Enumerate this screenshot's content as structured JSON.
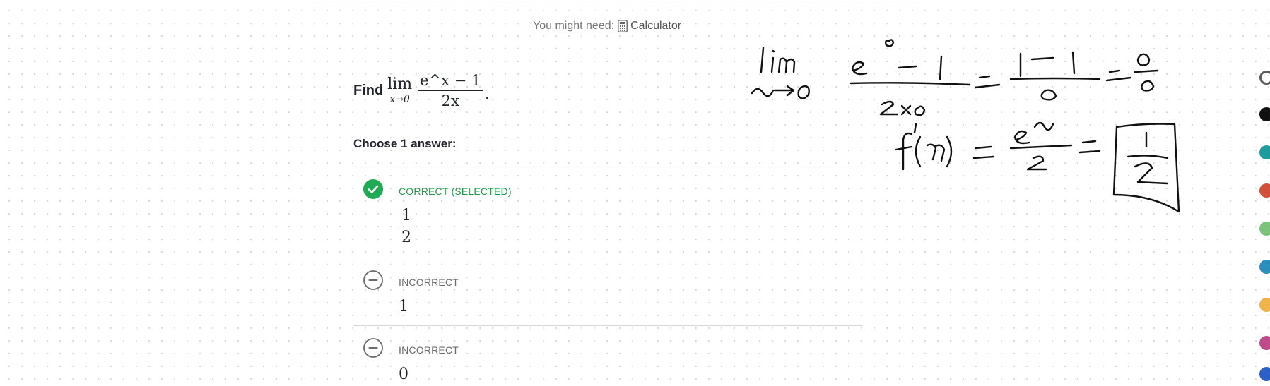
{
  "header": {
    "might_need_label": "You might need:",
    "calculator_label": "Calculator",
    "calculator_icon": "calculator-icon"
  },
  "question": {
    "find_label": "Find",
    "lim_word": "lim",
    "lim_sub": "x→0",
    "numerator": "e^x − 1",
    "denominator": "2x",
    "period": "."
  },
  "choose_label": "Choose 1 answer:",
  "choices": [
    {
      "status": "CORRECT (SELECTED)",
      "icon": "check-circle-icon",
      "value_numerator": "1",
      "value_denominator": "2"
    },
    {
      "status": "INCORRECT",
      "icon": "minus-circle-icon",
      "value": "1"
    },
    {
      "status": "INCORRECT",
      "icon": "minus-circle-icon",
      "value": "0"
    }
  ],
  "colors": {
    "correct_green": "#1fab54",
    "incorrect_gray": "#6b6b6b",
    "text_dark": "#21242c",
    "palette": [
      "#5b5b5b",
      "#111111",
      "#1c9c9e",
      "#d24f3a",
      "#7cc47b",
      "#2a8fbd",
      "#f0b44a",
      "#c14a8a",
      "#2d5fc9"
    ]
  }
}
